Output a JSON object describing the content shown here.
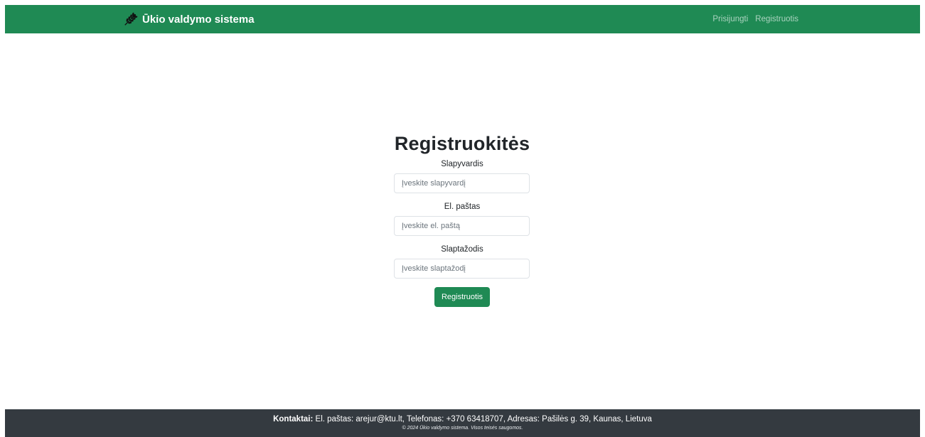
{
  "navbar": {
    "brand": "Ūkio valdymo sistema",
    "brand_icon": "wheat-icon",
    "links": [
      {
        "label": "Prisijungti"
      },
      {
        "label": "Registruotis"
      }
    ],
    "color": "#1f8a54"
  },
  "form": {
    "title": "Registruokitės",
    "username": {
      "label": "Slapyvardis",
      "placeholder": "Įveskite slapyvardį"
    },
    "email": {
      "label": "El. paštas",
      "placeholder": "Įveskite el. paštą"
    },
    "password": {
      "label": "Slaptažodis",
      "placeholder": "Įveskite slaptažodį"
    },
    "submit_label": "Registruotis"
  },
  "footer": {
    "contacts_label": "Kontaktai:",
    "contacts_text": " El. paštas: arejur@ktu.lt, Telefonas: +370 63418707, Adresas: Pašilės g. 39, Kaunas, Lietuva",
    "copyright": "© 2024 Ūkio valdymo sistema. Visos teisės saugomos.",
    "color": "#343a40"
  }
}
